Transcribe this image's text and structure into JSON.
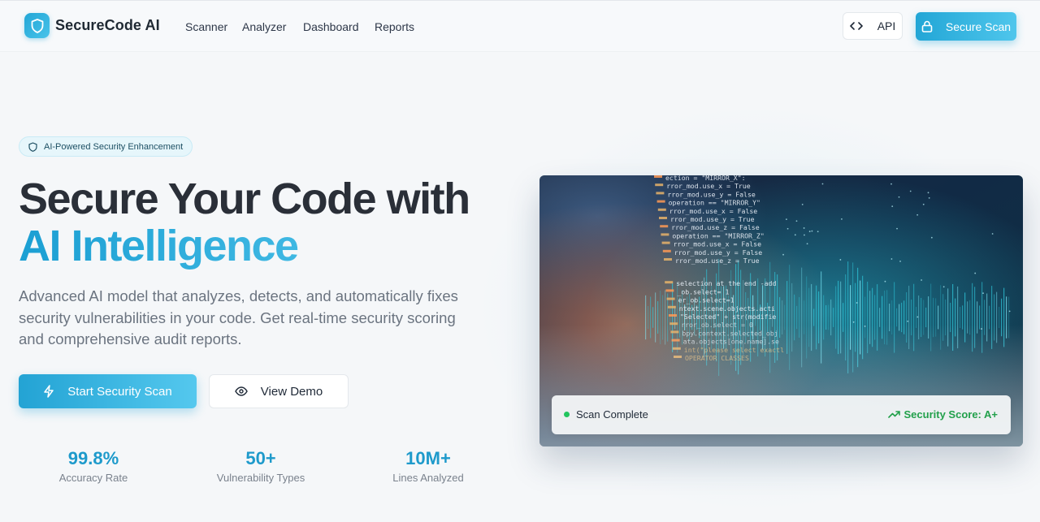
{
  "brand": {
    "name": "SecureCode AI",
    "logo_icon": "shield-icon"
  },
  "nav": {
    "links": [
      "Scanner",
      "Analyzer",
      "Dashboard",
      "Reports"
    ],
    "api_label": "API",
    "api_icon": "code-icon",
    "secure_scan_label": "Secure Scan",
    "secure_scan_icon": "lock-icon"
  },
  "hero": {
    "badge": "AI-Powered Security Enhancement",
    "badge_icon": "shield-icon",
    "headline_line1": "Secure Your Code with",
    "headline_line2": "AI Intelligence",
    "description": "Advanced AI model that analyzes, detects, and automatically fixes security vulnerabilities in your code. Get real-time security scoring and comprehensive audit reports.",
    "primary_cta": "Start Security Scan",
    "primary_cta_icon": "lightning-icon",
    "secondary_cta": "View Demo",
    "secondary_cta_icon": "eye-icon"
  },
  "stats": [
    {
      "value": "99.8%",
      "label": "Accuracy Rate"
    },
    {
      "value": "50+",
      "label": "Vulnerability Types"
    },
    {
      "value": "10M+",
      "label": "Lines Analyzed"
    }
  ],
  "scan_status": {
    "status": "Scan Complete",
    "score": "Security Score: A+",
    "score_icon": "trending-up-icon"
  },
  "code_lines": [
    "ection = \"MIRROR_X\":",
    "rror_mod.use_x = True",
    "rror_mod.use_y = False",
    "operation == \"MIRROR_Y\"",
    "rror_mod.use_x = False",
    "rror_mod.use_y = True",
    "rror_mod.use_z = False",
    "operation == \"MIRROR_Z\"",
    "rror_mod.use_x = False",
    "rror_mod.use_y = False",
    "rror_mod.use_z = True",
    "selection at the end -add",
    "_ob.select= 1",
    "er_ob.select=1",
    "ntext.scene.objects.acti",
    "\"Selected\" + str(modifie",
    "rror_ob.select = 0",
    "bpy.context.selected_obj",
    "ata.objects[one.name].se",
    "int(\"please select exactl",
    "OPERATOR CLASSES"
  ],
  "colors": {
    "accent": "#22a6d6",
    "accent_light": "#54c8ee",
    "success": "#22a04b"
  }
}
